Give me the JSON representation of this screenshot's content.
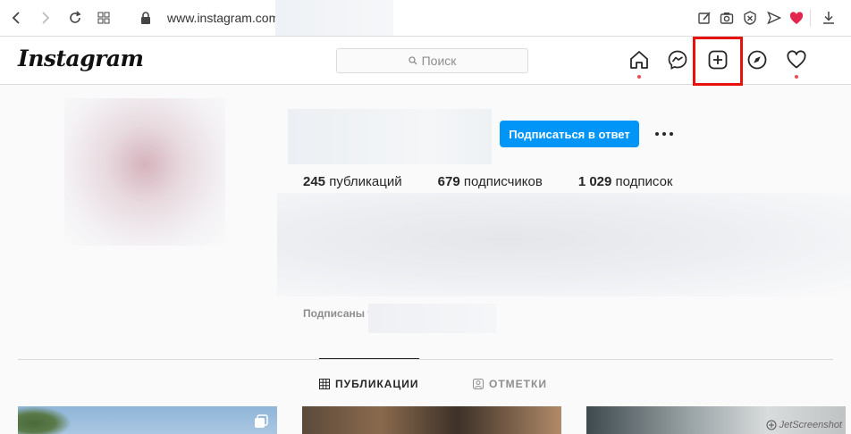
{
  "browser": {
    "url": "www.instagram.com"
  },
  "header": {
    "logo": "Instagram",
    "search_placeholder": "Поиск",
    "highlight_color": "#e8120d",
    "icons": [
      "home-icon",
      "messenger-icon",
      "new-post-icon",
      "explore-icon",
      "activity-icon"
    ]
  },
  "profile": {
    "follow_back_label": "Подписаться в ответ",
    "more_label": "•••",
    "stats": [
      {
        "count": "245",
        "label": "публикаций"
      },
      {
        "count": "679",
        "label": "подписчиков"
      },
      {
        "count": "1 029",
        "label": "подписок"
      }
    ],
    "followed_by": "Подписаны t"
  },
  "tabs": {
    "posts_label": "ПУБЛИКАЦИИ",
    "tagged_label": "ОТМЕТКИ"
  },
  "watermark": "JetScreenshot"
}
